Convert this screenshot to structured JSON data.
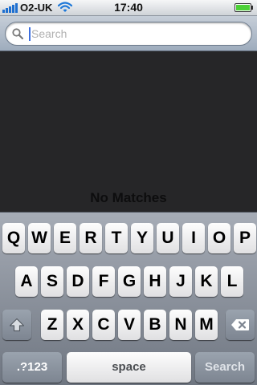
{
  "status_bar": {
    "carrier": "O2-UK",
    "time": "17:40",
    "icons": [
      "signal-bars-icon",
      "wifi-icon",
      "battery-icon"
    ]
  },
  "search": {
    "placeholder": "Search",
    "value": "",
    "icon": "search-icon"
  },
  "results": {
    "empty_message": "No Matches"
  },
  "keyboard": {
    "row1": [
      "Q",
      "W",
      "E",
      "R",
      "T",
      "Y",
      "U",
      "I",
      "O",
      "P"
    ],
    "row2": [
      "A",
      "S",
      "D",
      "F",
      "G",
      "H",
      "J",
      "K",
      "L"
    ],
    "row3": [
      "Z",
      "X",
      "C",
      "V",
      "B",
      "N",
      "M"
    ],
    "shift_icon": "shift-arrow-icon",
    "delete_icon": "delete-backspace-icon",
    "numbers_label": ".?123",
    "space_label": "space",
    "search_label": "Search"
  },
  "colors": {
    "caret": "#3d6fe0",
    "battery_fill": "#4cd137",
    "wifi_blue": "#1e78d8"
  }
}
